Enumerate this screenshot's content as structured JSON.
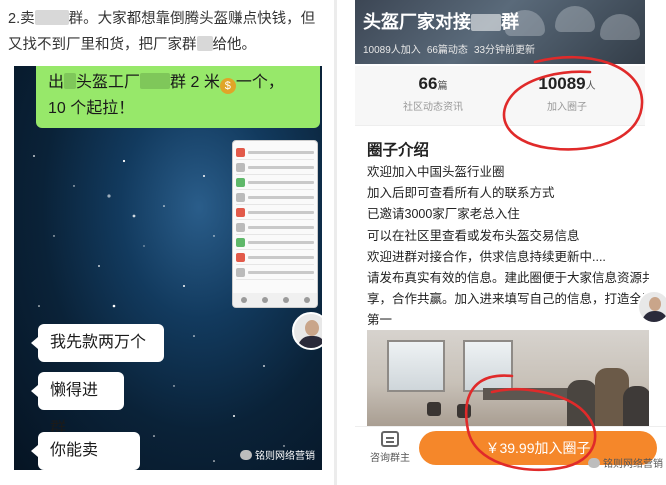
{
  "left": {
    "caption_prefix": "2.卖",
    "caption_mid": "群。大家都想靠倒腾头盔赚点快钱，但又找不到厂里和货，把厂家群",
    "caption_suffix": "给他。",
    "chat_top": {
      "part1": "出",
      "part2": "头盔工厂",
      "part3": "群 2 米",
      "money_icon": "money-bag-icon",
      "part4": "一个，",
      "line2": "10 个起拉！"
    },
    "bubbles": [
      "我先款两万个",
      "懒得进群",
      "你能卖吗？"
    ],
    "watermark": "铭则网络营销"
  },
  "right": {
    "banner": {
      "title": "头盔厂家对接",
      "title_suffix": "群",
      "joined": "10089人加入",
      "posts": "66篇动态",
      "updated": "33分钟前更新"
    },
    "stats": [
      {
        "value": "66",
        "unit": "篇",
        "label": "社区动态资讯"
      },
      {
        "value": "10089",
        "unit": "人",
        "label": "加入圈子"
      }
    ],
    "intro": {
      "title": "圈子介绍",
      "lines": [
        "欢迎加入中国头盔行业圈",
        "加入后即可查看所有人的联系方式",
        "已邀请3000家厂家老总入住",
        "可以在社区里查看或发布头盔交易信息",
        "欢迎进群对接合作，供求信息持续更新中....",
        "请发布真实有效的信息。建此圈便于大家信息资源共",
        "享，合作共赢。加入进来填写自己的信息，打造全国",
        "第一"
      ]
    },
    "bottom": {
      "consult_label": "咨询群主",
      "join_label": "￥39.99加入圈子"
    },
    "watermark": "铭则网络营销"
  },
  "colors": {
    "wechat_green": "#97e86a",
    "join_orange": "#f5872a",
    "annotation_red": "#e02a2a"
  }
}
